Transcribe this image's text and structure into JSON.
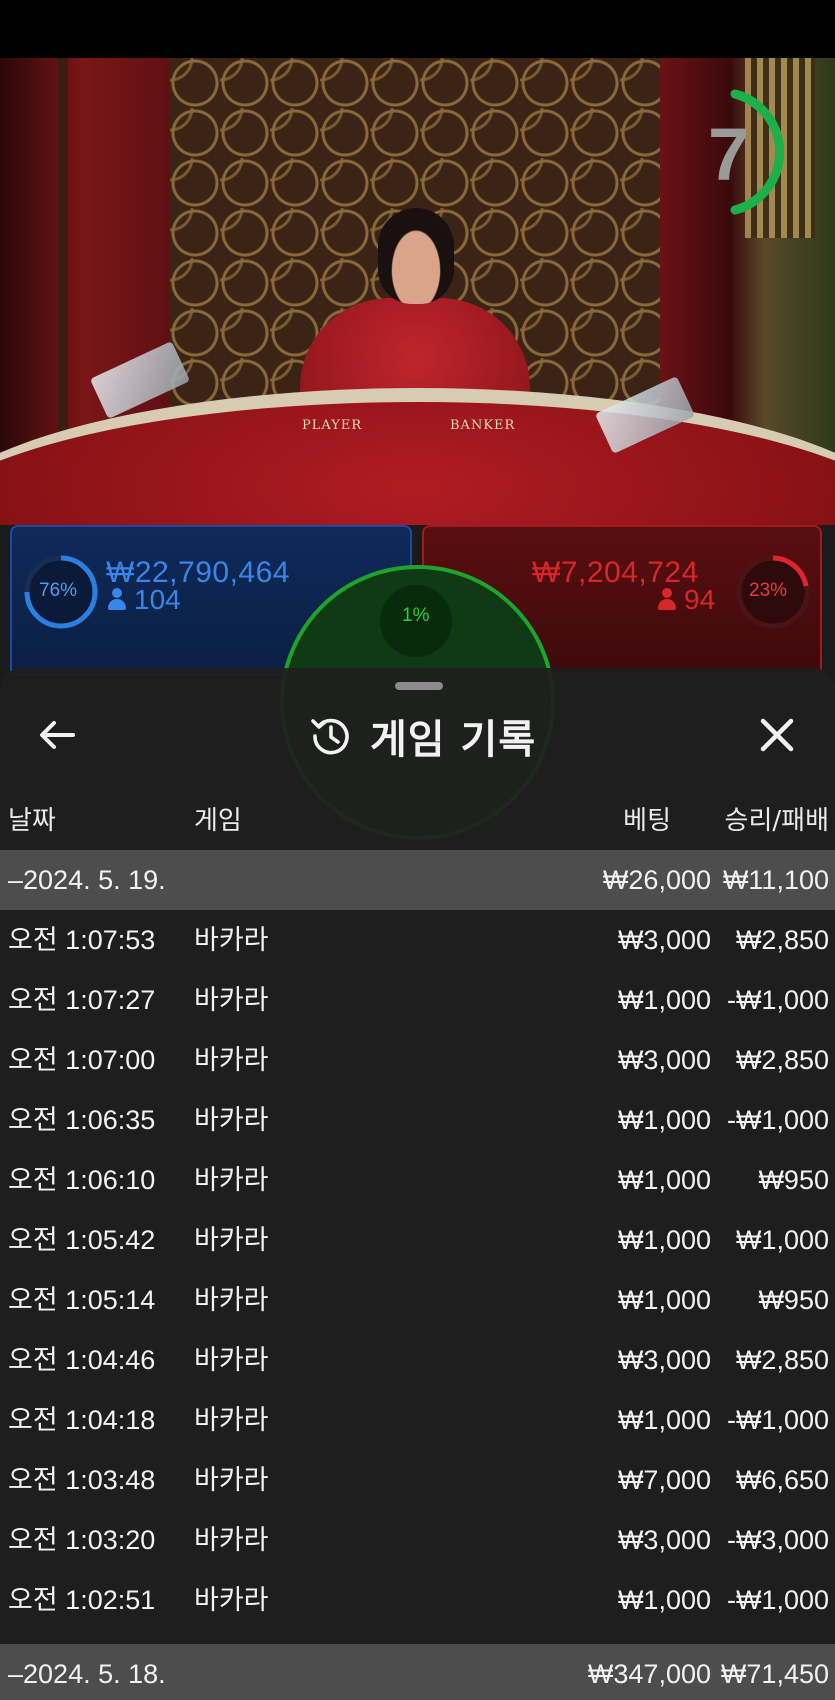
{
  "stream": {
    "timer_value": "7",
    "table_labels": {
      "player": "PLAYER",
      "banker": "BANKER"
    }
  },
  "bets": {
    "player": {
      "percent": "76%",
      "amount": "₩22,790,464",
      "count": "104"
    },
    "banker": {
      "percent": "23%",
      "amount": "₩7,204,724",
      "count": "94"
    },
    "tie": {
      "percent": "1%"
    }
  },
  "sheet": {
    "title": "게임 기록",
    "back_icon": "arrow-left-icon",
    "history_icon": "history-clock-icon",
    "close_icon": "close-icon",
    "columns": {
      "date": "날짜",
      "game": "게임",
      "bet": "베팅",
      "result": "승리/패배"
    },
    "groups": [
      {
        "date": "–2024. 5. 19.",
        "bet_total": "₩26,000",
        "result_total": "₩11,100",
        "rows": [
          {
            "time": "오전 1:07:53",
            "game": "바카라",
            "bet": "₩3,000",
            "result": "₩2,850"
          },
          {
            "time": "오전 1:07:27",
            "game": "바카라",
            "bet": "₩1,000",
            "result": "-₩1,000"
          },
          {
            "time": "오전 1:07:00",
            "game": "바카라",
            "bet": "₩3,000",
            "result": "₩2,850"
          },
          {
            "time": "오전 1:06:35",
            "game": "바카라",
            "bet": "₩1,000",
            "result": "-₩1,000"
          },
          {
            "time": "오전 1:06:10",
            "game": "바카라",
            "bet": "₩1,000",
            "result": "₩950"
          },
          {
            "time": "오전 1:05:42",
            "game": "바카라",
            "bet": "₩1,000",
            "result": "₩1,000"
          },
          {
            "time": "오전 1:05:14",
            "game": "바카라",
            "bet": "₩1,000",
            "result": "₩950"
          },
          {
            "time": "오전 1:04:46",
            "game": "바카라",
            "bet": "₩3,000",
            "result": "₩2,850"
          },
          {
            "time": "오전 1:04:18",
            "game": "바카라",
            "bet": "₩1,000",
            "result": "-₩1,000"
          },
          {
            "time": "오전 1:03:48",
            "game": "바카라",
            "bet": "₩7,000",
            "result": "₩6,650"
          },
          {
            "time": "오전 1:03:20",
            "game": "바카라",
            "bet": "₩3,000",
            "result": "-₩3,000"
          },
          {
            "time": "오전 1:02:51",
            "game": "바카라",
            "bet": "₩1,000",
            "result": "-₩1,000"
          }
        ]
      },
      {
        "date": "–2024. 5. 18.",
        "bet_total": "₩347,000",
        "result_total": "₩71,450",
        "rows": []
      }
    ]
  }
}
